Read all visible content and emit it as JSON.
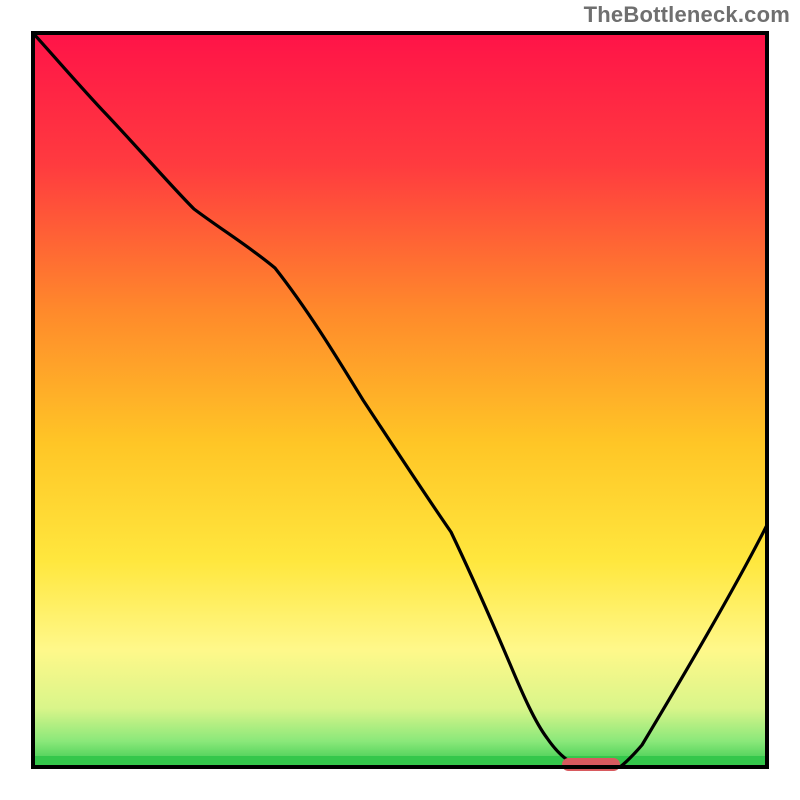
{
  "attribution": {
    "watermark": "TheBottleneck.com"
  },
  "colors": {
    "border": "#000000",
    "curve": "#000000",
    "marker": "#d85a5f",
    "baseline_green": "#34c74b"
  },
  "chart_data": {
    "type": "line",
    "title": "",
    "xlabel": "",
    "ylabel": "",
    "xlim": [
      0,
      100
    ],
    "ylim": [
      0,
      100
    ],
    "grid": false,
    "legend": false,
    "annotations": [],
    "background": {
      "type": "vertical_gradient",
      "stops": [
        {
          "pos": 0.0,
          "color": "#ff1348"
        },
        {
          "pos": 0.18,
          "color": "#ff3b3f"
        },
        {
          "pos": 0.38,
          "color": "#ff8a2b"
        },
        {
          "pos": 0.56,
          "color": "#ffc626"
        },
        {
          "pos": 0.72,
          "color": "#ffe73e"
        },
        {
          "pos": 0.84,
          "color": "#fff88a"
        },
        {
          "pos": 0.92,
          "color": "#d9f58a"
        },
        {
          "pos": 0.965,
          "color": "#8ae87a"
        },
        {
          "pos": 1.0,
          "color": "#34c74b"
        }
      ]
    },
    "series": [
      {
        "name": "bottleneck_curve",
        "x": [
          0,
          10,
          22,
          33,
          45,
          57,
          65,
          70,
          75,
          80,
          83,
          100
        ],
        "y": [
          100,
          89,
          76,
          68,
          50,
          32,
          14,
          4,
          0,
          0,
          3,
          33
        ]
      }
    ],
    "optimal_marker": {
      "x_start": 72,
      "x_end": 80,
      "y": 0
    }
  }
}
